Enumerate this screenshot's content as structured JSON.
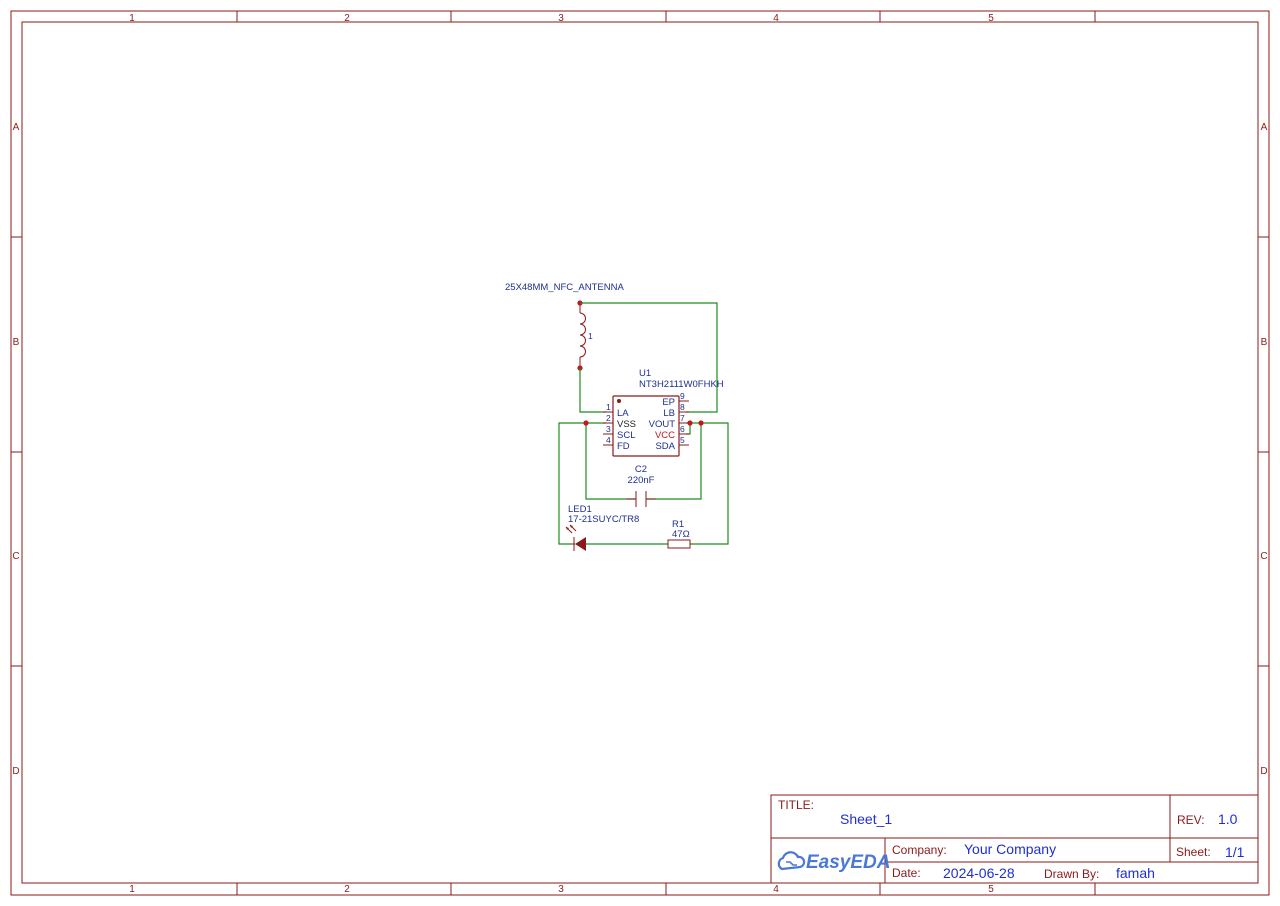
{
  "sheet": {
    "columns": [
      "1",
      "2",
      "3",
      "4",
      "5"
    ],
    "rows": [
      "A",
      "B",
      "C",
      "D"
    ]
  },
  "components": {
    "antenna": {
      "name": "25X48MM_NFC_ANTENNA",
      "pin_label": "1"
    },
    "u1": {
      "ref": "U1",
      "value": "NT3H2111W0FHKH",
      "left_pins": [
        {
          "num": "1",
          "name": "LA"
        },
        {
          "num": "2",
          "name": "VSS"
        },
        {
          "num": "3",
          "name": "SCL"
        },
        {
          "num": "4",
          "name": "FD"
        }
      ],
      "right_pins": [
        {
          "num": "9",
          "name": "EP"
        },
        {
          "num": "8",
          "name": "LB"
        },
        {
          "num": "7",
          "name": "VOUT"
        },
        {
          "num": "6",
          "name": "VCC"
        },
        {
          "num": "5",
          "name": "SDA"
        }
      ]
    },
    "c2": {
      "ref": "C2",
      "value": "220nF"
    },
    "led1": {
      "ref": "LED1",
      "value": "17-21SUYC/TR8"
    },
    "r1": {
      "ref": "R1",
      "value": "47Ω"
    }
  },
  "title_block": {
    "title_label": "TITLE:",
    "title_value": "Sheet_1",
    "rev_label": "REV:",
    "rev_value": "1.0",
    "company_label": "Company:",
    "company_value": "Your Company",
    "sheet_label": "Sheet:",
    "sheet_value": "1/1",
    "date_label": "Date:",
    "date_value": "2024-06-28",
    "drawn_label": "Drawn By:",
    "drawn_value": "famah",
    "logo_text": "EasyEDA"
  },
  "colors": {
    "frame": "#8b1a1a",
    "wire": "#1e8c1e",
    "text": "#1f2f8f",
    "junction": "#c0181b",
    "logo": "#4a78d6"
  }
}
